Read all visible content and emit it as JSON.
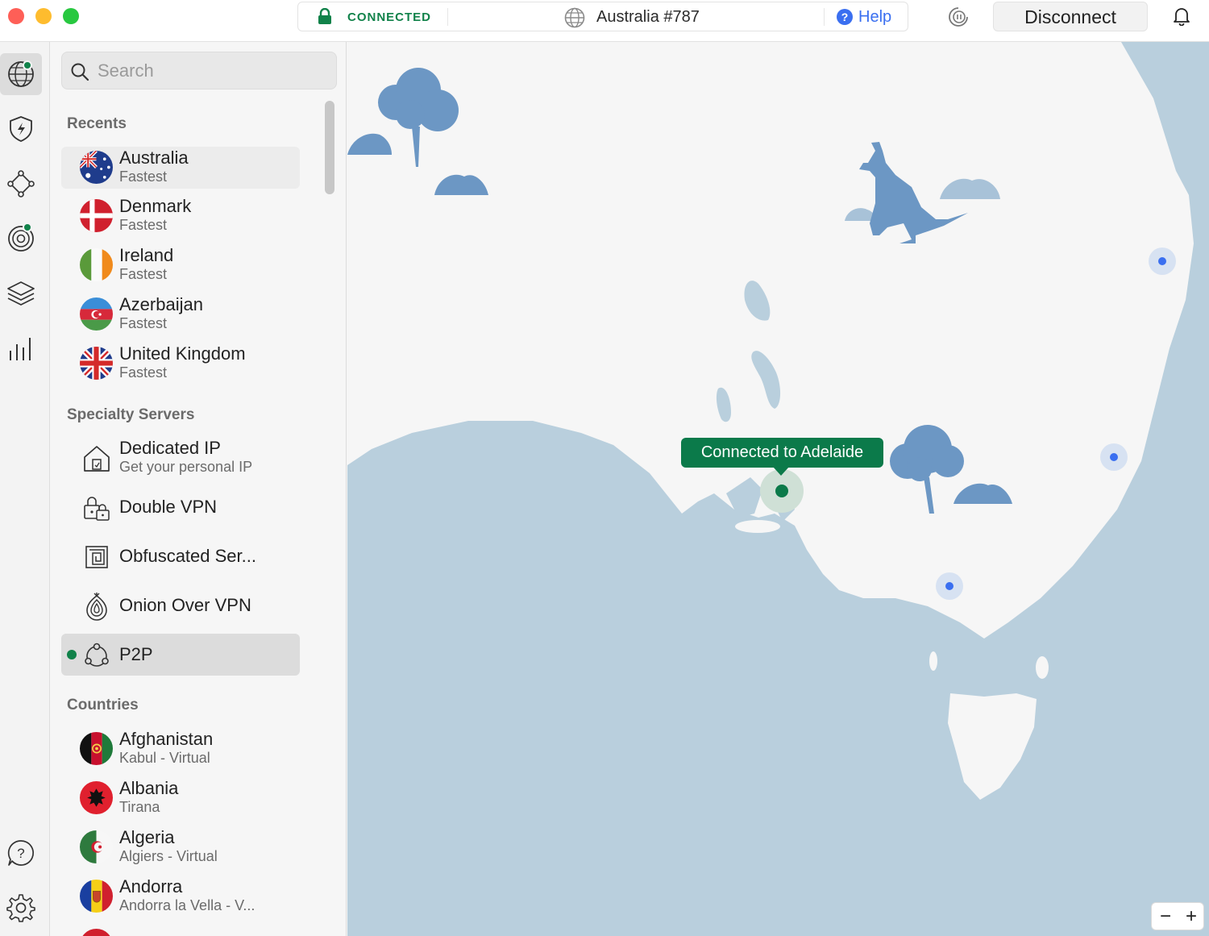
{
  "titlebar": {
    "status": "CONNECTED",
    "server": "Australia #787",
    "help": "Help",
    "disconnect": "Disconnect"
  },
  "colors": {
    "accent_green": "#11824a",
    "help_blue": "#3a6ff0",
    "sea": "#b9cfdd",
    "land": "#f6f6f6",
    "illustration": "#6c97c4"
  },
  "rail": {
    "icons": [
      "globe-icon",
      "threat-protection-icon",
      "meshnet-icon",
      "dark-web-monitor-icon",
      "layers-icon",
      "stats-icon",
      "support-icon",
      "settings-icon"
    ]
  },
  "search": {
    "placeholder": "Search"
  },
  "sections": {
    "recents": "Recents",
    "specialty": "Specialty Servers",
    "countries": "Countries"
  },
  "recents": [
    {
      "name": "Australia",
      "sub": "Fastest"
    },
    {
      "name": "Denmark",
      "sub": "Fastest"
    },
    {
      "name": "Ireland",
      "sub": "Fastest"
    },
    {
      "name": "Azerbaijan",
      "sub": "Fastest"
    },
    {
      "name": "United Kingdom",
      "sub": "Fastest"
    }
  ],
  "specialty": [
    {
      "name": "Dedicated IP",
      "sub": "Get your personal IP",
      "icon": "house-icon"
    },
    {
      "name": "Double VPN",
      "icon": "double-lock-icon"
    },
    {
      "name": "Obfuscated Ser...",
      "icon": "maze-icon"
    },
    {
      "name": "Onion Over VPN",
      "icon": "onion-icon"
    },
    {
      "name": "P2P",
      "icon": "p2p-icon"
    }
  ],
  "countries": [
    {
      "name": "Afghanistan",
      "sub": "Kabul - Virtual"
    },
    {
      "name": "Albania",
      "sub": "Tirana"
    },
    {
      "name": "Algeria",
      "sub": "Algiers - Virtual"
    },
    {
      "name": "Andorra",
      "sub": "Andorra la Vella - V..."
    }
  ],
  "map": {
    "tooltip": "Connected to Adelaide",
    "zoom_out": "−",
    "zoom_in": "+"
  }
}
